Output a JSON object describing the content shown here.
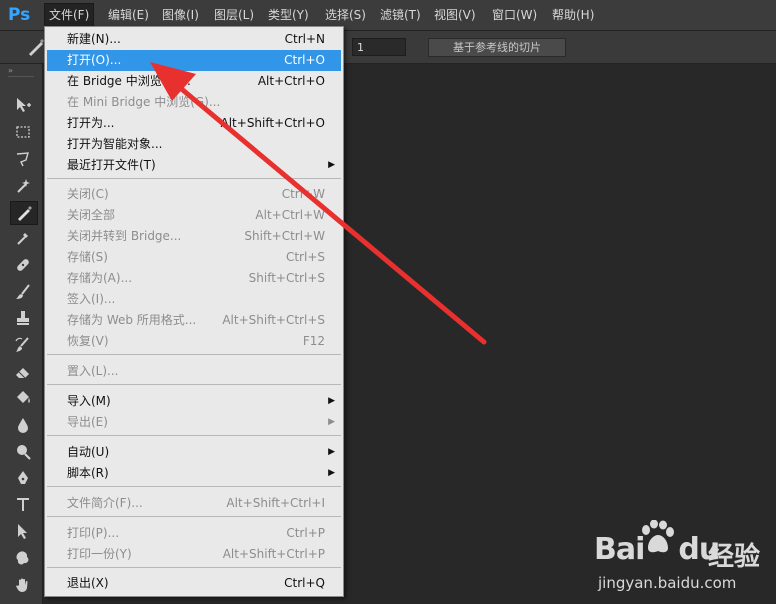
{
  "app": {
    "logo": "Ps"
  },
  "menubar": [
    {
      "label": "文件(F)",
      "active": true
    },
    {
      "label": "编辑(E)"
    },
    {
      "label": "图像(I)"
    },
    {
      "label": "图层(L)"
    },
    {
      "label": "类型(Y)"
    },
    {
      "label": "选择(S)"
    },
    {
      "label": "滤镜(T)"
    },
    {
      "label": "视图(V)"
    },
    {
      "label": "窗口(W)"
    },
    {
      "label": "帮助(H)"
    }
  ],
  "options_bar": {
    "field_value": "1",
    "slices_button": "基于参考线的切片"
  },
  "toolbar": {
    "grip": "»",
    "tools": [
      "move-tool-icon",
      "marquee-tool-icon",
      "lasso-tool-icon",
      "magic-wand-tool-icon",
      "slice-tool-icon",
      "eyedropper-tool-icon",
      "healing-brush-tool-icon",
      "brush-tool-icon",
      "clone-stamp-tool-icon",
      "history-brush-tool-icon",
      "eraser-tool-icon",
      "paint-bucket-tool-icon",
      "blur-tool-icon",
      "dodge-tool-icon",
      "pen-tool-icon",
      "type-tool-icon",
      "path-selection-tool-icon",
      "shape-tool-icon",
      "hand-tool-icon"
    ]
  },
  "file_menu": {
    "items": [
      {
        "label": "新建(N)...",
        "shortcut": "Ctrl+N"
      },
      {
        "label": "打开(O)...",
        "shortcut": "Ctrl+O",
        "highlight": true
      },
      {
        "label": "在 Bridge 中浏览(B)...",
        "shortcut": "Alt+Ctrl+O"
      },
      {
        "label": "在 Mini Bridge 中浏览(G)...",
        "shortcut": "",
        "disabled": true
      },
      {
        "label": "打开为...",
        "shortcut": "Alt+Shift+Ctrl+O"
      },
      {
        "label": "打开为智能对象...",
        "shortcut": ""
      },
      {
        "label": "最近打开文件(T)",
        "shortcut": "",
        "submenu": true
      },
      {
        "separator": true
      },
      {
        "label": "关闭(C)",
        "shortcut": "Ctrl+W",
        "disabled": true
      },
      {
        "label": "关闭全部",
        "shortcut": "Alt+Ctrl+W",
        "disabled": true
      },
      {
        "label": "关闭并转到 Bridge...",
        "shortcut": "Shift+Ctrl+W",
        "disabled": true
      },
      {
        "label": "存储(S)",
        "shortcut": "Ctrl+S",
        "disabled": true
      },
      {
        "label": "存储为(A)...",
        "shortcut": "Shift+Ctrl+S",
        "disabled": true
      },
      {
        "label": "签入(I)...",
        "shortcut": "",
        "disabled": true
      },
      {
        "label": "存储为 Web 所用格式...",
        "shortcut": "Alt+Shift+Ctrl+S",
        "disabled": true
      },
      {
        "label": "恢复(V)",
        "shortcut": "F12",
        "disabled": true
      },
      {
        "separator": true
      },
      {
        "label": "置入(L)...",
        "shortcut": "",
        "disabled": true
      },
      {
        "separator": true
      },
      {
        "label": "导入(M)",
        "shortcut": "",
        "submenu": true
      },
      {
        "label": "导出(E)",
        "shortcut": "",
        "submenu": true,
        "disabled": true
      },
      {
        "separator": true
      },
      {
        "label": "自动(U)",
        "shortcut": "",
        "submenu": true
      },
      {
        "label": "脚本(R)",
        "shortcut": "",
        "submenu": true
      },
      {
        "separator": true
      },
      {
        "label": "文件简介(F)...",
        "shortcut": "Alt+Shift+Ctrl+I",
        "disabled": true
      },
      {
        "separator": true
      },
      {
        "label": "打印(P)...",
        "shortcut": "Ctrl+P",
        "disabled": true
      },
      {
        "label": "打印一份(Y)",
        "shortcut": "Alt+Shift+Ctrl+P",
        "disabled": true
      },
      {
        "separator": true
      },
      {
        "label": "退出(X)",
        "shortcut": "Ctrl+Q"
      }
    ]
  },
  "watermark": {
    "brand": "Bai",
    "brand2": "du",
    "product": "经验",
    "url": "jingyan.baidu.com"
  },
  "colors": {
    "highlight": "#3296e8",
    "annotation_arrow": "#e8312f",
    "logo": "#36a5ff"
  }
}
